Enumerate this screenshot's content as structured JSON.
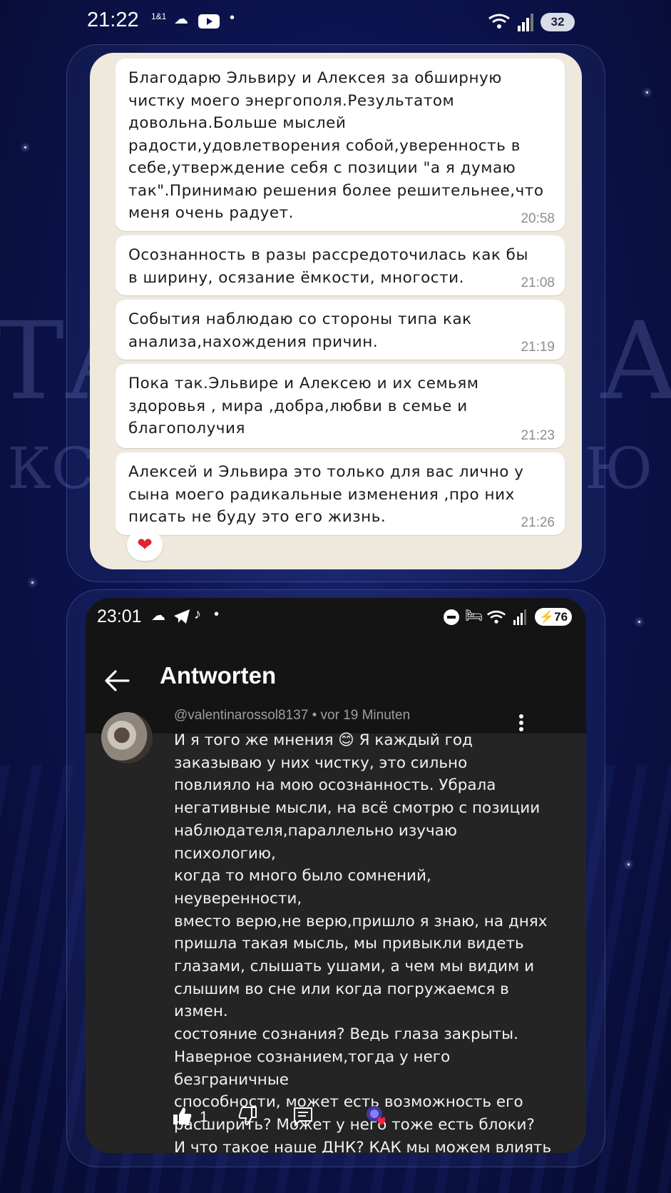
{
  "phone_status_top": {
    "time": "21:22",
    "carrier": "1&1",
    "battery": "32"
  },
  "chat": {
    "messages": [
      {
        "text": "Благодарю Эльвиру  и Алексея за обширную\nчистку моего энергополя.Результатом\nдовольна.Больше мыслей\nрадости,удовлетворения собой,уверенность в\nсебе,утверждение себя с позиции \"а  я думаю\nтак\".Принимаю решения более  решительнее,что\nменя очень радует.",
        "time": "20:58"
      },
      {
        "text": "Осознанность в разы  рассредоточилась как бы\nв ширину, осязание ёмкости,  многости.",
        "time": "21:08"
      },
      {
        "text": "События наблюдаю со стороны типа как\nанализа,нахождения причин.",
        "time": "21:19"
      },
      {
        "text": "Пока так.Эльвире и Алексею и их семьям\nздоровья , мира ,добра,любви в семье и\nблагополучия",
        "time": "21:23"
      },
      {
        "text": "Алексей и Эльвира это только для вас лично у\nсына моего радикальные изменения ,про них\nписать не буду это его жизнь.",
        "time": "21:26"
      }
    ],
    "reaction": "❤"
  },
  "youtube": {
    "status": {
      "time": "23:01",
      "battery": "76"
    },
    "header_title": "Antworten",
    "comment": {
      "author": "@valentinarossol8137",
      "age": "vor 19 Minuten",
      "meta": "@valentinarossol8137 • vor 19 Minuten",
      "text": "И я того же мнения 😊 Я каждый год\nзаказываю у них чистку, это сильно\nповлияло на мою осознанность. Убрала\nнегативные мысли, на всё смотрю с позиции\nнаблюдателя,параллельно изучаю психологию,\nкогда то много было сомнений, неуверенности,\nвместо верю,не верю,пришло я знаю, на днях\nпришла такая мысль, мы привыкли видеть\nглазами, слышать ушами, а чем мы видим и\nслышим во сне или когда погружаемся в измен.\nсостояние сознания? Ведь глаза закрыты.\nНаверное сознанием,тогда у него безграничные\nспособности, может есть возможность его\nрасширить? Может у него тоже есть блоки?\nИ что такое наше ДНК? КАК мы можем влиять\nна него? В плане активации....",
      "like_count": "1"
    },
    "icons": [
      "back-arrow-icon",
      "more-vert-icon",
      "thumbs-up-icon",
      "thumbs-down-icon",
      "reply-icon",
      "creator-heart-icon"
    ]
  }
}
